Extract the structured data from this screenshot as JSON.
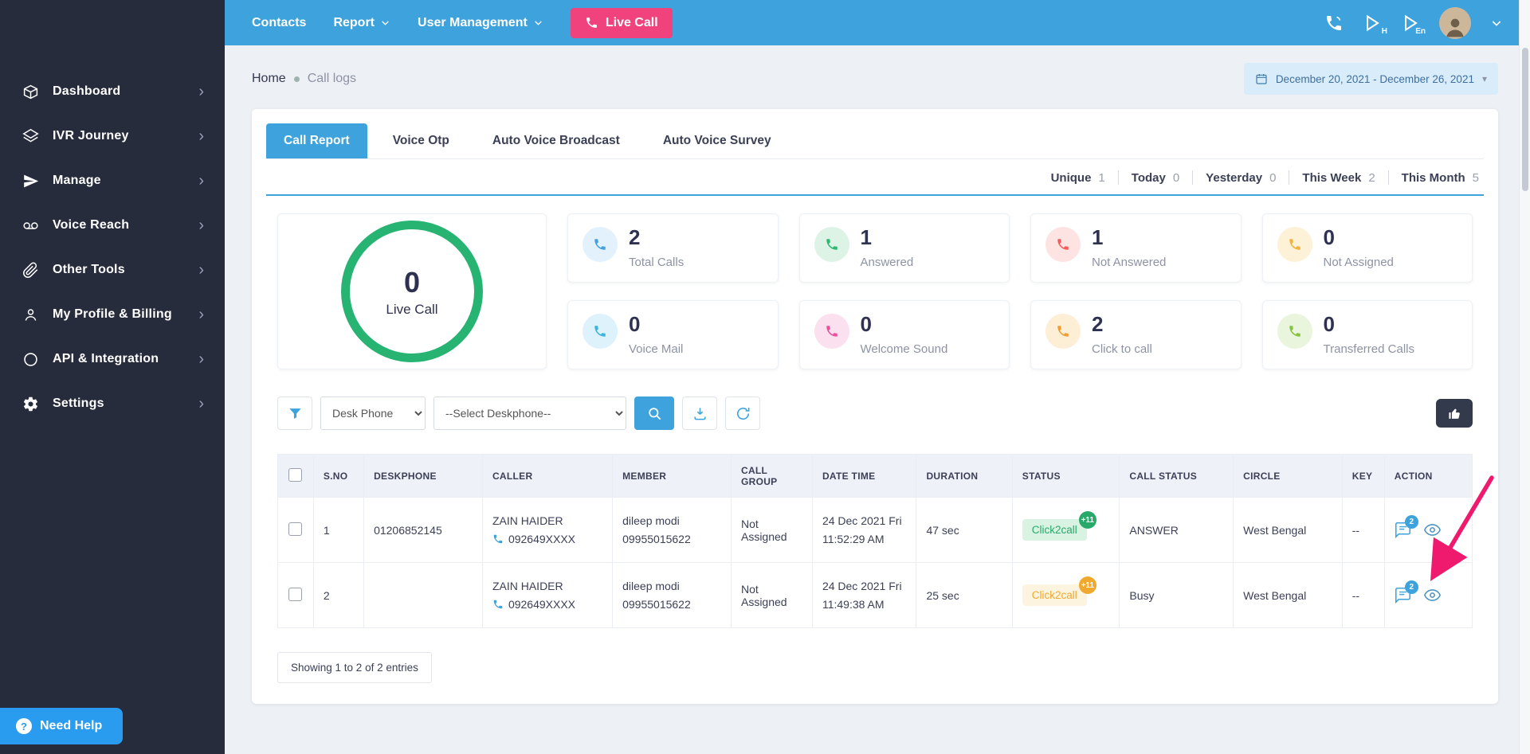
{
  "colors": {
    "accent_blue": "#3ea2dc",
    "sidebar_dark": "#272c3d",
    "live_call_pink": "#f0437d",
    "ring_green": "#27b473",
    "annotation_arrow": "#ef1a6e"
  },
  "topnav": {
    "contacts": "Contacts",
    "report": "Report",
    "user_management": "User Management",
    "live_call": "Live Call",
    "audio_badge_hindi": "H",
    "audio_badge_english": "En"
  },
  "sidebar": {
    "items": [
      {
        "label": "Dashboard"
      },
      {
        "label": "IVR Journey"
      },
      {
        "label": "Manage"
      },
      {
        "label": "Voice Reach"
      },
      {
        "label": "Other Tools"
      },
      {
        "label": "My Profile & Billing"
      },
      {
        "label": "API & Integration"
      },
      {
        "label": "Settings"
      }
    ],
    "need_help": "Need Help"
  },
  "breadcrumb": {
    "home": "Home",
    "current": "Call logs"
  },
  "date_range": {
    "label": "December 20, 2021 - December 26, 2021"
  },
  "tabs": {
    "call_report": "Call Report",
    "voice_otp": "Voice Otp",
    "auto_voice_broadcast": "Auto Voice Broadcast",
    "auto_voice_survey": "Auto Voice Survey"
  },
  "quick_stats": [
    {
      "label": "Unique",
      "value": "1"
    },
    {
      "label": "Today",
      "value": "0"
    },
    {
      "label": "Yesterday",
      "value": "0"
    },
    {
      "label": "This Week",
      "value": "2"
    },
    {
      "label": "This Month",
      "value": "5"
    }
  ],
  "live_call_card": {
    "value": "0",
    "label": "Live Call"
  },
  "stat_cards": [
    {
      "value": "2",
      "label": "Total Calls",
      "icon_style": "background:#e2f1fc;color:#44a1dd"
    },
    {
      "value": "1",
      "label": "Answered",
      "icon_style": "background:#ddf3e6;color:#2eb873"
    },
    {
      "value": "1",
      "label": "Not Answered",
      "icon_style": "background:#fde3e1;color:#f05d5d"
    },
    {
      "value": "0",
      "label": "Not Assigned",
      "icon_style": "background:#fdf2d7;color:#f2b33c"
    },
    {
      "value": "0",
      "label": "Voice Mail",
      "icon_style": "background:#def2fb;color:#3db3dd"
    },
    {
      "value": "0",
      "label": "Welcome Sound",
      "icon_style": "background:#fbe0ef;color:#e8519c"
    },
    {
      "value": "2",
      "label": "Click to call",
      "icon_style": "background:#fdeed6;color:#f29d38"
    },
    {
      "value": "0",
      "label": "Transferred Calls",
      "icon_style": "background:#e9f5dc;color:#84c441"
    }
  ],
  "filter_bar": {
    "type_select_value": "Desk Phone",
    "deskphone_select_value": "--Select Deskphone--"
  },
  "table": {
    "headers": [
      "S.NO",
      "DESKPHONE",
      "CALLER",
      "MEMBER",
      "CALL GROUP",
      "DATE TIME",
      "DURATION",
      "STATUS",
      "CALL STATUS",
      "CIRCLE",
      "KEY",
      "ACTION"
    ],
    "rows": [
      {
        "sno": "1",
        "deskphone": "01206852145",
        "caller_name": "ZAIN HAIDER",
        "caller_phone": "092649XXXX",
        "member_name": "dileep modi",
        "member_phone": "09955015622",
        "call_group": "Not Assigned",
        "date": "24 Dec 2021 Fri",
        "time": "11:52:29 AM",
        "duration": "47 sec",
        "status": "Click2call",
        "status_badge": "+11",
        "status_style": "background:#d8f3e2;color:#28a96a",
        "badge_style": "background:#28a96a",
        "call_status": "ANSWER",
        "circle": "West Bengal",
        "key": "--",
        "chat_badge": "2"
      },
      {
        "sno": "2",
        "deskphone": "",
        "caller_name": "ZAIN HAIDER",
        "caller_phone": "092649XXXX",
        "member_name": "dileep modi",
        "member_phone": "09955015622",
        "call_group": "Not Assigned",
        "date": "24 Dec 2021 Fri",
        "time": "11:49:38 AM",
        "duration": "25 sec",
        "status": "Click2call",
        "status_badge": "+11",
        "status_style": "background:#fdf4df;color:#f0a92d",
        "badge_style": "background:#f0a92d",
        "call_status": "Busy",
        "circle": "West Bengal",
        "key": "--",
        "chat_badge": "2"
      }
    ]
  },
  "footer": {
    "showing": "Showing 1 to 2 of 2 entries"
  }
}
